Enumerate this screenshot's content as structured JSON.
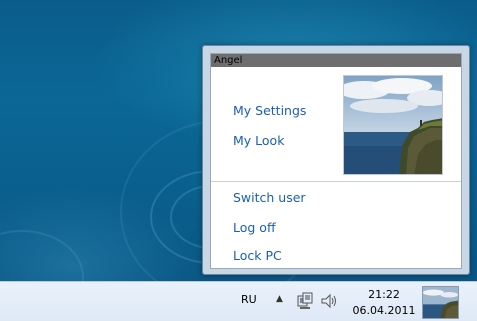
{
  "desktop": {
    "background": "teal-blue-swirl"
  },
  "user_menu": {
    "username": "Angel",
    "items": [
      {
        "label": "My Settings"
      },
      {
        "label": "My Look"
      }
    ],
    "session_items": [
      {
        "label": "Switch user"
      },
      {
        "label": "Log off"
      },
      {
        "label": "Lock PC"
      }
    ],
    "picture": "coastal-cliff-photo"
  },
  "taskbar": {
    "language": "RU",
    "tray_icons": [
      "chevron-up-icon",
      "network-icon",
      "volume-icon"
    ],
    "time": "21:22",
    "date": "06.04.2011",
    "user_thumbnail": "coastal-cliff-photo"
  },
  "colors": {
    "link": "#1a5fb4",
    "title_bar": "#6e6e6e",
    "desktop": "#0b6796",
    "taskbar": "#e4edf8"
  }
}
